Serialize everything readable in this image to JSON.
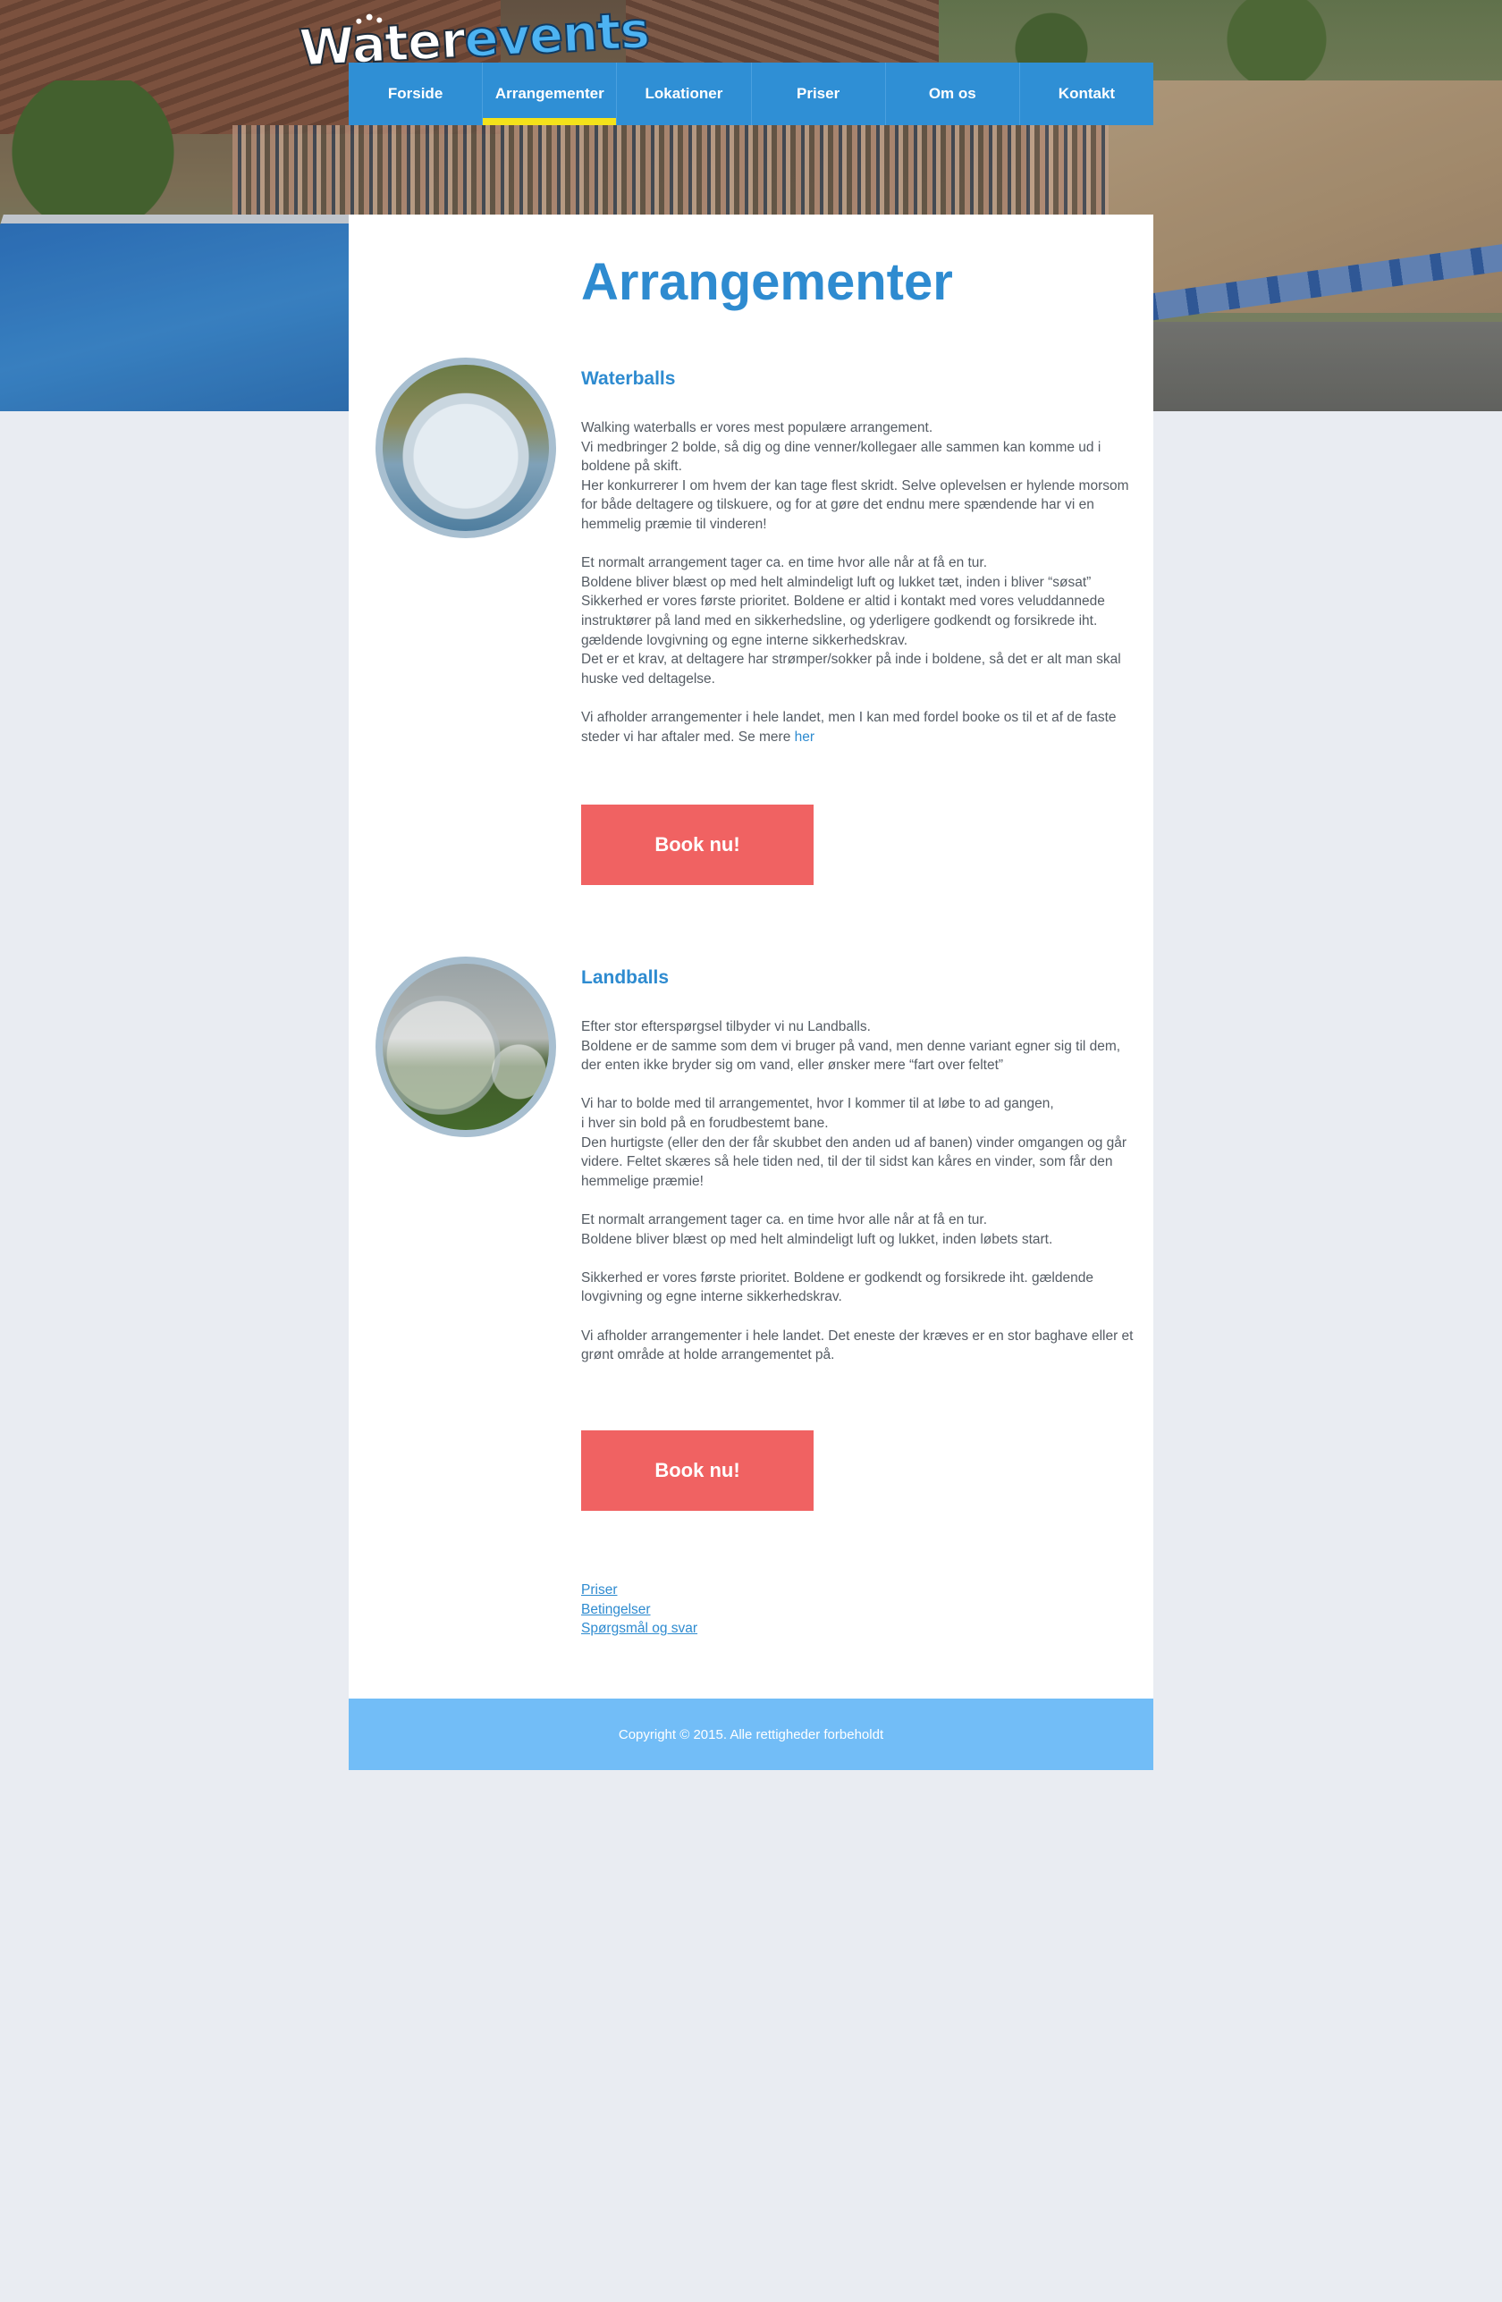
{
  "logo": {
    "part1": "Water",
    "part2": "events"
  },
  "nav": {
    "items": [
      {
        "label": "Forside"
      },
      {
        "label": "Arrangementer",
        "active": true
      },
      {
        "label": "Lokationer"
      },
      {
        "label": "Priser"
      },
      {
        "label": "Om os"
      },
      {
        "label": "Kontakt"
      }
    ]
  },
  "page": {
    "title": "Arrangementer"
  },
  "sections": [
    {
      "title": "Waterballs",
      "paragraphs": [
        [
          "Walking waterballs er vores mest populære arrangement.",
          "Vi medbringer 2 bolde, så dig og dine venner/kollegaer alle sammen kan komme ud i boldene på skift.",
          "Her konkurrerer I om hvem der kan tage flest skridt. Selve oplevelsen er hylende morsom for både deltagere og tilskuere, og for at gøre det endnu mere spændende har vi en hemmelig præmie til vinderen!"
        ],
        [
          "Et normalt arrangement tager ca. en time hvor alle når at få en tur.",
          "Boldene bliver blæst op med helt almindeligt luft og lukket tæt, inden i bliver “søsat”",
          "Sikkerhed er vores første prioritet. Boldene er altid i kontakt med vores veluddannede instruktører på land med en sikkerhedsline, og yderligere godkendt og forsikrede iht. gældende lovgivning og egne interne sikkerhedskrav.",
          "Det er et krav, at deltagere har strømper/sokker på inde i boldene, så det er alt man skal huske ved deltagelse."
        ],
        [
          "Vi afholder arrangementer i hele landet, men I kan med fordel booke os til et af de faste steder vi har aftaler med. Se mere"
        ]
      ],
      "link_label": "her",
      "button_label": "Book nu!"
    },
    {
      "title": "Landballs",
      "paragraphs": [
        [
          "Efter stor efterspørgsel tilbyder vi nu Landballs.",
          "Boldene er de samme som dem vi bruger på vand, men denne variant egner sig til dem, der enten ikke bryder sig om vand, eller ønsker mere “fart over feltet”"
        ],
        [
          "Vi har to bolde med til arrangementet, hvor I kommer til at løbe to ad gangen,",
          "i hver sin bold på en forudbestemt bane.",
          "Den hurtigste (eller den der får skubbet den anden ud af banen) vinder omgangen og går videre. Feltet skæres så hele tiden ned, til der til sidst kan kåres en vinder, som får den hemmelige præmie!"
        ],
        [
          "Et normalt arrangement tager ca. en time hvor alle når at få en tur.",
          "Boldene bliver blæst op med helt almindeligt luft og lukket, inden løbets start."
        ],
        [
          "Sikkerhed er vores første prioritet. Boldene er godkendt og forsikrede iht. gældende lovgivning og egne interne sikkerhedskrav."
        ],
        [
          "Vi afholder arrangementer i hele landet. Det eneste der kræves er en stor baghave eller et grønt område at holde arrangementet på."
        ]
      ],
      "button_label": "Book nu!"
    }
  ],
  "footer_links": [
    "Priser",
    "Betingelser",
    "Spørgsmål og svar"
  ],
  "footer": {
    "copyright": "Copyright © 2015. Alle rettigheder forbeholdt"
  },
  "colors": {
    "nav": "#2f8fd5",
    "nav_active_underline": "#f4e21a",
    "title": "#2e8bd0",
    "button": "#f06262",
    "footer": "#72bdf7",
    "background": "#e9ecf2"
  }
}
